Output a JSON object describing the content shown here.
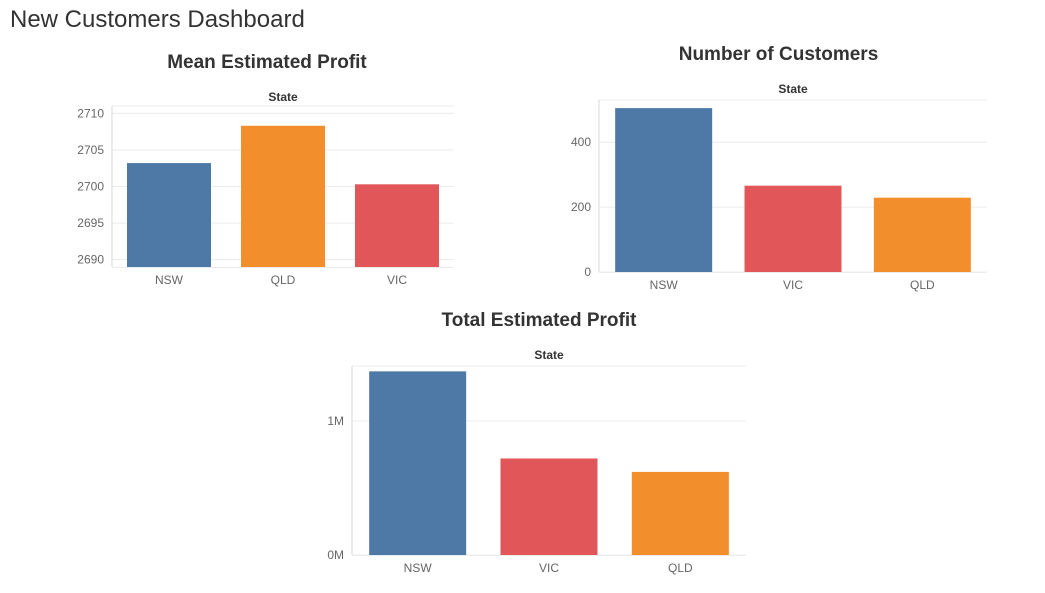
{
  "dashboard": {
    "title": "New Customers Dashboard"
  },
  "colors": {
    "NSW": "#4e79a7",
    "QLD": "#f28e2b",
    "VIC": "#e15759",
    "gridline": "#ececec",
    "axis_line": "#d9d9d9",
    "tick_text": "#666666",
    "title_text": "#333333"
  },
  "chart_data": [
    {
      "id": "mean-profit",
      "type": "bar",
      "title": "Mean Estimated Profit",
      "column_header": "State",
      "categories": [
        "NSW",
        "QLD",
        "VIC"
      ],
      "values": [
        2703.2,
        2708.3,
        2700.3
      ],
      "ylim": [
        2689,
        2711
      ],
      "yticks": [
        2690,
        2695,
        2700,
        2705,
        2710
      ],
      "ytick_labels": [
        "2690",
        "2695",
        "2700",
        "2705",
        "2710"
      ],
      "grid": true
    },
    {
      "id": "num-customers",
      "type": "bar",
      "title": "Number of Customers",
      "column_header": "State",
      "categories": [
        "NSW",
        "VIC",
        "QLD"
      ],
      "values": [
        505,
        266,
        229
      ],
      "ylim": [
        0,
        530
      ],
      "yticks": [
        0,
        200,
        400
      ],
      "ytick_labels": [
        "0",
        "200",
        "400"
      ],
      "grid": true
    },
    {
      "id": "total-profit",
      "type": "bar",
      "title": "Total Estimated Profit",
      "column_header": "State",
      "categories": [
        "NSW",
        "VIC",
        "QLD"
      ],
      "values": [
        1370000,
        720000,
        620000
      ],
      "ylim": [
        0,
        1410000
      ],
      "yticks": [
        0,
        1000000
      ],
      "ytick_labels": [
        "0M",
        "1M"
      ],
      "grid": true
    }
  ]
}
